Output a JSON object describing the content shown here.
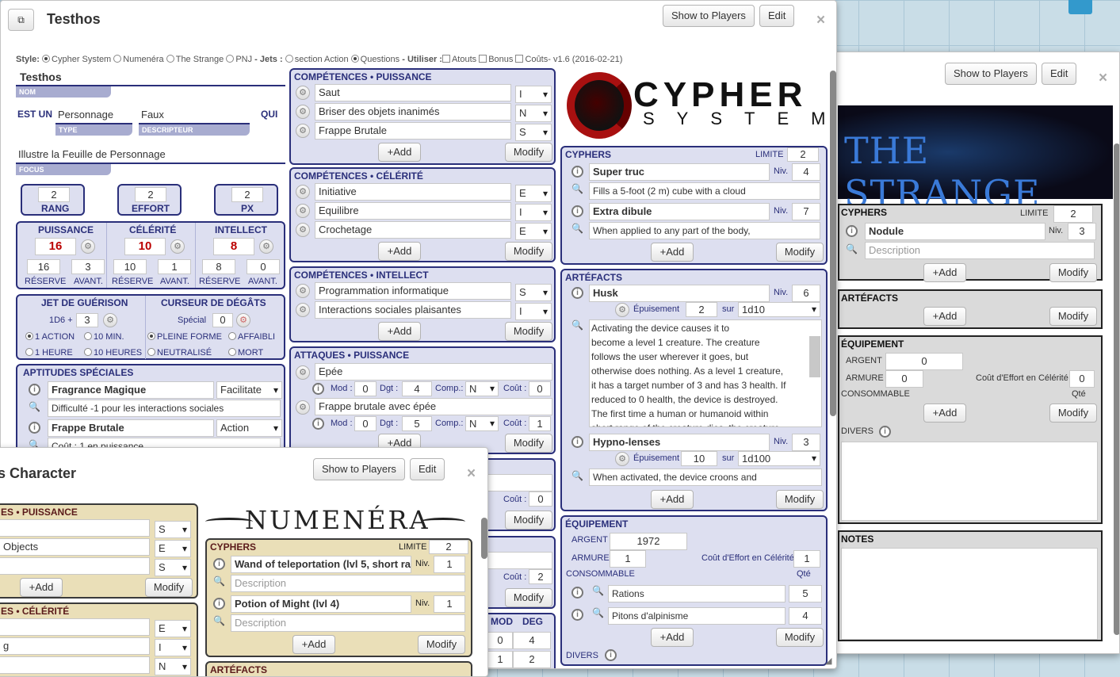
{
  "strange": {
    "show": "Show to Players",
    "edit": "Edit",
    "close": "×",
    "logo": "THE STRANGE",
    "cyphers": {
      "title": "CYPHERS",
      "limite_label": "LIMITE",
      "limite": "2",
      "name": "Nodule",
      "niv_label": "Niv.",
      "niv": "3",
      "desc_ph": "Description",
      "add": "+Add",
      "modify": "Modify"
    },
    "artefacts": {
      "title": "ARTÉFACTS",
      "add": "+Add",
      "modify": "Modify"
    },
    "equip": {
      "title": "ÉQUIPEMENT",
      "argent_label": "ARGENT",
      "argent": "0",
      "armure_label": "ARMURE",
      "armure": "0",
      "cout_label": "Coût d'Effort en Célérité",
      "cout": "0",
      "conso_label": "CONSOMMABLE",
      "qte_label": "Qté",
      "add": "+Add",
      "modify": "Modify",
      "divers_label": "DIVERS"
    },
    "notes": "NOTES"
  },
  "main": {
    "title": "Testhos",
    "show": "Show to Players",
    "edit": "Edit",
    "close": "×",
    "style_line": {
      "style": "Style:",
      "opts": [
        "Cypher System",
        "Numenéra",
        "The Strange",
        "PNJ"
      ],
      "jets": "- Jets :",
      "action": "section Action",
      "questions": "Questions",
      "utiliser": "- Utiliser :",
      "atouts": "Atouts",
      "bonus": "Bonus",
      "couts": "Coûts",
      "version": "- v1.6 (2016-02-21)"
    },
    "nom": "Testhos",
    "nom_label": "NOM",
    "est_un": "EST UN",
    "type": "Personnage",
    "type_label": "TYPE",
    "descr": "Faux",
    "descr_label": "DESCRIPTEUR",
    "qui": "QUI",
    "focus": "Illustre la Feuille de Personnage",
    "focus_label": "FOCUS",
    "rang": "2",
    "rang_label": "RANG",
    "effort": "2",
    "effort_label": "EFFORT",
    "px": "2",
    "px_label": "PX",
    "pools": [
      {
        "label": "PUISSANCE",
        "val": "16",
        "res": "16",
        "avant": "3"
      },
      {
        "label": "CÉLÉRITÉ",
        "val": "10",
        "res": "10",
        "avant": "1"
      },
      {
        "label": "INTELLECT",
        "val": "8",
        "res": "8",
        "avant": "0"
      }
    ],
    "reserve_label": "RÉSERVE",
    "avant_label": "AVANT.",
    "jet_label": "JET DE GUÉRISON",
    "jet_dice": "1D6 +",
    "jet_val": "3",
    "jet_opts": [
      "1 ACTION",
      "10 MIN.",
      "1 HEURE",
      "10 HEURES"
    ],
    "curseur_label": "CURSEUR DE DÉGÂTS",
    "special_label": "Spécial",
    "special_val": "0",
    "curseur_opts": [
      "PLEINE FORME",
      "AFFAIBLI",
      "NEUTRALISÉ",
      "MORT"
    ],
    "aptitudes": {
      "title": "APTITUDES SPÉCIALES",
      "items": [
        {
          "name": "Fragrance Magique",
          "type": "Facilitate",
          "desc": "Difficulté -1 pour les interactions sociales"
        },
        {
          "name": "Frappe Brutale",
          "type": "Action",
          "desc": "Coût : 1 en puissance"
        }
      ]
    },
    "comp_p": {
      "title": "COMPÉTENCES • PUISSANCE",
      "items": [
        {
          "name": "Saut",
          "lvl": "I"
        },
        {
          "name": "Briser des objets inanimés",
          "lvl": "N"
        },
        {
          "name": "Frappe Brutale",
          "lvl": "S"
        }
      ],
      "add": "+Add",
      "modify": "Modify"
    },
    "comp_c": {
      "title": "COMPÉTENCES • CÉLÉRITÉ",
      "items": [
        {
          "name": "Initiative",
          "lvl": "E"
        },
        {
          "name": "Equilibre",
          "lvl": "I"
        },
        {
          "name": "Crochetage",
          "lvl": "E"
        }
      ],
      "add": "+Add",
      "modify": "Modify"
    },
    "comp_i": {
      "title": "COMPÉTENCES • INTELLECT",
      "items": [
        {
          "name": "Programmation informatique",
          "lvl": "S"
        },
        {
          "name": "Interactions sociales plaisantes",
          "lvl": "I"
        }
      ],
      "add": "+Add",
      "modify": "Modify"
    },
    "attaques": {
      "title": "ATTAQUES • PUISSANCE",
      "mod_label": "Mod :",
      "dgt_label": "Dgt :",
      "comp_label": "Comp.:",
      "cout_label": "Coût :",
      "items": [
        {
          "name": "Epée",
          "mod": "0",
          "dgt": "4",
          "comp": "N",
          "cout": "0"
        },
        {
          "name": "Frappe brutale avec épée",
          "mod": "0",
          "dgt": "5",
          "comp": "N",
          "cout": "1"
        }
      ],
      "add": "+Add",
      "modify": "Modify"
    },
    "hidden": {
      "cout1": "0",
      "modify1": "Modify",
      "cout2": "2",
      "modify2": "Modify",
      "mod_h": "MOD",
      "deg_h": "DEG",
      "mod": "0",
      "deg": "4",
      "mod2": "1",
      "deg2": "2"
    },
    "logo1": "CYPHER",
    "logo2": "SYSTEM",
    "cyphers": {
      "title": "CYPHERS",
      "limite_label": "LIMITE",
      "limite": "2",
      "niv_label": "Niv.",
      "items": [
        {
          "name": "Super truc",
          "niv": "4",
          "desc": "Fills a 5-foot (2 m) cube with a cloud"
        },
        {
          "name": "Extra dibule",
          "niv": "7",
          "desc": "When applied to any part of the body,"
        }
      ],
      "add": "+Add",
      "modify": "Modify"
    },
    "artefacts": {
      "title": "ARTÉFACTS",
      "niv_label": "Niv.",
      "epuis_label": "Épuisement",
      "sur_label": "sur",
      "a1": {
        "name": "Husk",
        "niv": "6",
        "epuis": "2",
        "die": "1d10",
        "lines": [
          "Activating the device causes it to",
          "become a level 1 creature. The creature",
          "follows the user wherever it goes, but",
          "otherwise does nothing. As a level 1 creature,",
          "it has a target number of 3 and has 3 health. If",
          "reduced to 0 health, the device is destroyed.",
          "The first time a human or humanoid within",
          "short range of the creature dies, the creature"
        ]
      },
      "a2": {
        "name": "Hypno-lenses",
        "niv": "3",
        "epuis": "10",
        "die": "1d100",
        "desc": "When activated, the device croons and"
      },
      "add": "+Add",
      "modify": "Modify"
    },
    "equip": {
      "title": "ÉQUIPEMENT",
      "argent_label": "ARGENT",
      "argent": "1972",
      "armure_label": "ARMURE",
      "armure": "1",
      "cout_label": "Coût d'Effort en Célérité",
      "cout": "1",
      "conso_label": "CONSOMMABLE",
      "qte_label": "Qté",
      "items": [
        {
          "name": "Rations",
          "qte": "5"
        },
        {
          "name": "Pitons d'alpinisme",
          "qte": "4"
        }
      ],
      "add": "+Add",
      "modify": "Modify",
      "divers_label": "DIVERS"
    }
  },
  "numenera": {
    "title": "s Character",
    "show": "Show to Players",
    "edit": "Edit",
    "close": "×",
    "logo": "NUMENÉRA",
    "p": {
      "title": "ES • PUISSANCE",
      "rows": [
        {
          "name": "",
          "lvl": "S"
        },
        {
          "name": "Objects",
          "lvl": "E"
        },
        {
          "name": "",
          "lvl": "S"
        }
      ],
      "add": "+Add",
      "modify": "Modify"
    },
    "c": {
      "title": "ES • CÉLÉRITÉ",
      "rows": [
        {
          "name": "",
          "lvl": "E"
        },
        {
          "name": "g",
          "lvl": "I"
        },
        {
          "name": "",
          "lvl": "N"
        }
      ]
    },
    "cyphers": {
      "title": "CYPHERS",
      "limite_label": "LIMITE",
      "limite": "2",
      "niv_label": "Niv.",
      "items": [
        {
          "name": "Wand of teleportation (lvl 5, short ra",
          "niv": "1"
        },
        {
          "name": "Potion of Might (lvl 4)",
          "niv": "1"
        }
      ],
      "desc_ph": "Description",
      "add": "+Add",
      "modify": "Modify"
    },
    "artefacts": "ARTÉFACTS"
  }
}
